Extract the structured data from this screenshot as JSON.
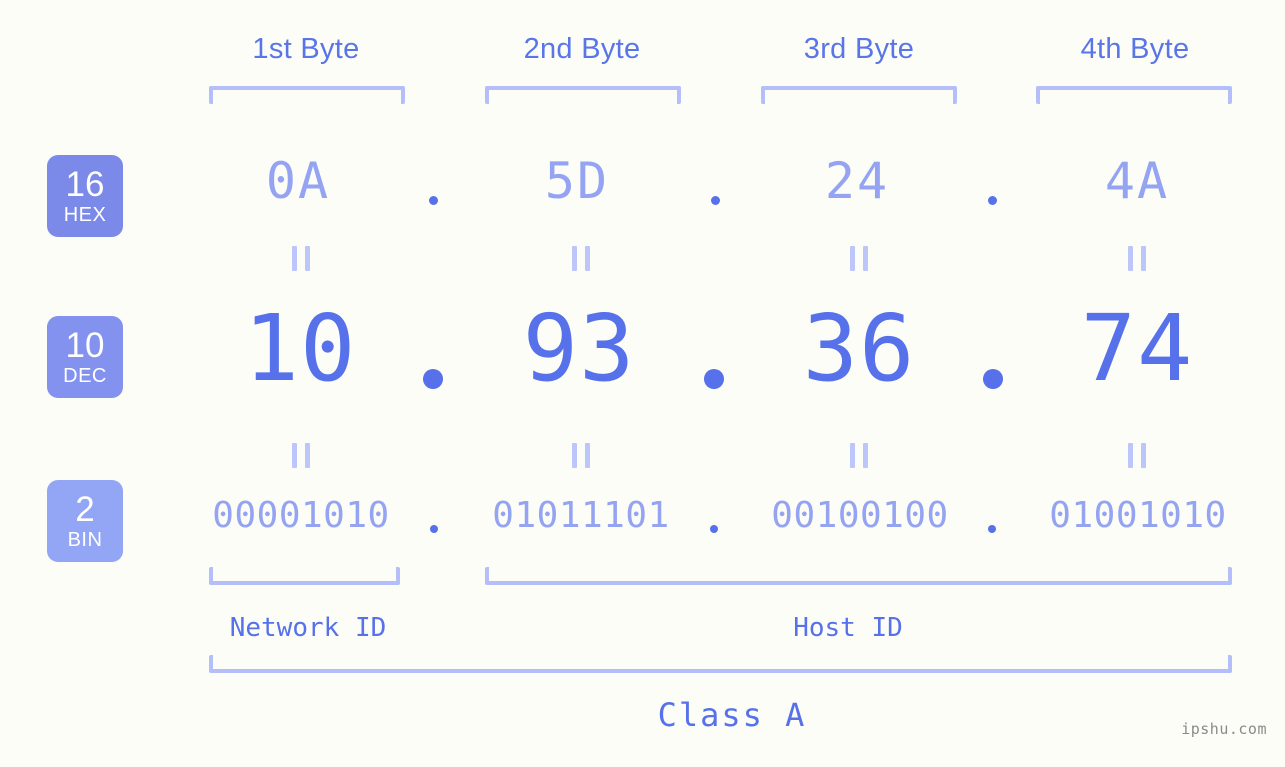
{
  "diagram": {
    "watermark": "ipshu.com",
    "byte_headers": [
      {
        "label": "1st Byte"
      },
      {
        "label": "2nd Byte"
      },
      {
        "label": "3rd Byte"
      },
      {
        "label": "4th Byte"
      }
    ],
    "bases": [
      {
        "number": "16",
        "name": "HEX",
        "color": "#7b8ae8"
      },
      {
        "number": "10",
        "name": "DEC",
        "color": "#8292ee"
      },
      {
        "number": "2",
        "name": "BIN",
        "color": "#93a5f5"
      }
    ],
    "rows": {
      "hex": {
        "values": [
          "0A",
          "5D",
          "24",
          "4A"
        ],
        "separator": "."
      },
      "dec": {
        "values": [
          "10",
          "93",
          "36",
          "74"
        ],
        "separator": "."
      },
      "bin": {
        "values": [
          "00001010",
          "01011101",
          "00100100",
          "01001010"
        ],
        "separator": "."
      }
    },
    "equality_symbol": "=",
    "sections": [
      {
        "label": "Network ID"
      },
      {
        "label": "Host ID"
      }
    ],
    "class_label": "Class A",
    "colors": {
      "background": "#fcfdf7",
      "accent_strong": "#5671ea",
      "accent_light": "#94a3f2",
      "bracket": "#b4bffa"
    }
  }
}
